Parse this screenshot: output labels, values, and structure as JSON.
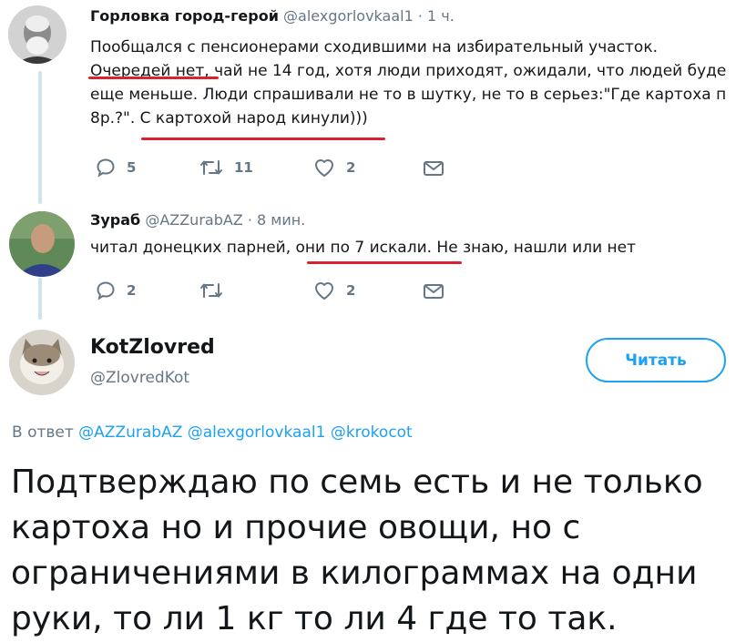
{
  "tweet1": {
    "display_name": "Горловка город-герой",
    "handle": "@alexgorlovkaal1",
    "time": "· 1 ч.",
    "lines": [
      "Пообщался с пенсионерами сходившими на избирательный участок.",
      "Очередей нет, чай не 14 год, хотя люди приходят, ожидали, что людей буде",
      "еще меньше. Люди спрашивали не то в шутку, не то в серьез:\"Где картоха п",
      "8р.?\". С картохой народ кинули)))"
    ],
    "replies": "5",
    "retweets": "11",
    "likes": "2"
  },
  "tweet2": {
    "display_name": "Зураб",
    "handle": "@AZZurabAZ",
    "time": "· 8 мин.",
    "text": "читал донецких парней, они по 7 искали. Не знаю, нашли или нет",
    "replies": "2",
    "retweets": "",
    "likes": "2"
  },
  "main": {
    "display_name": "KotZlovred",
    "handle": "@ZlovredKot",
    "follow_label": "Читать",
    "reply_prefix": "В ответ",
    "reply_mentions": [
      "@AZZurabAZ",
      "@alexgorlovkaal1",
      "@krokocot"
    ],
    "text_lines": [
      "Подтверждаю по семь есть и не только",
      "картоха но и прочие овощи, но с",
      "ограничениями в килограммах на одни",
      "руки, то ли 1 кг то ли 4 где то так."
    ]
  },
  "colors": {
    "accent": "#1da1f2",
    "muted": "#657786",
    "underline": "#d9232e",
    "thread_line": "#cfe3ec"
  },
  "icons": [
    "reply-icon",
    "retweet-icon",
    "like-icon",
    "message-icon"
  ]
}
